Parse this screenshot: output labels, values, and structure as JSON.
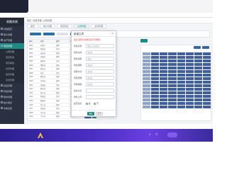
{
  "sidebar": {
    "title": "易融系统",
    "items": [
      {
        "label": "系统首页"
      },
      {
        "label": "客户管理"
      },
      {
        "label": "资产管理"
      },
      {
        "label": "项目管理",
        "active": true
      },
      {
        "label": "立项管理",
        "sub": true,
        "active": true
      },
      {
        "label": "项目查询",
        "sub": true
      },
      {
        "label": "项目审批",
        "sub": true
      },
      {
        "label": "合同管理",
        "sub": true
      },
      {
        "label": "放款管理",
        "sub": true
      },
      {
        "label": "还款管理",
        "sub": true
      },
      {
        "label": "贷后管理"
      },
      {
        "label": "风险管理"
      },
      {
        "label": "财务管理"
      },
      {
        "label": "统计报表"
      },
      {
        "label": "系统设置"
      }
    ]
  },
  "header": {
    "breadcrumb": "首页 / 项目管理 / 立项管理"
  },
  "tabs": [
    {
      "label": "首页"
    },
    {
      "label": "客户管理"
    },
    {
      "label": "项目列表"
    },
    {
      "label": "立项管理",
      "active": true
    },
    {
      "label": "合同管理"
    }
  ],
  "table": {
    "headers": [
      "编号",
      "名称",
      "类型",
      "状态"
    ],
    "rows": [
      [
        "0001",
        "房地产",
        "抵押",
        "审批中"
      ],
      [
        "0002",
        "制造业",
        "信用",
        "已放款"
      ],
      [
        "0003",
        "批发业",
        "担保",
        "审批中"
      ],
      [
        "0004",
        "运输业",
        "抵押",
        "已完成"
      ],
      [
        "0005",
        "建筑业",
        "信用",
        "审批中"
      ],
      [
        "0006",
        "零售业",
        "担保",
        "已放款"
      ],
      [
        "0007",
        "服务业",
        "抵押",
        "已完成"
      ],
      [
        "0008",
        "农业",
        "信用",
        "审批中"
      ],
      [
        "0009",
        "餐饮业",
        "担保",
        "已放款"
      ],
      [
        "0010",
        "信息业",
        "抵押",
        "审批中"
      ],
      [
        "0011",
        "金融业",
        "信用",
        "已完成"
      ],
      [
        "0012",
        "教育业",
        "担保",
        "审批中"
      ],
      [
        "0013",
        "医疗业",
        "抵押",
        "已放款"
      ],
      [
        "0014",
        "物流业",
        "信用",
        "已完成"
      ],
      [
        "0015",
        "能源业",
        "担保",
        "审批中"
      ],
      [
        "0016",
        "化工业",
        "抵押",
        "已放款"
      ],
      [
        "0017",
        "纺织业",
        "信用",
        "审批中"
      ],
      [
        "0018",
        "电子业",
        "担保",
        "已完成"
      ],
      [
        "0019",
        "汽车业",
        "抵押",
        "审批中"
      ]
    ]
  },
  "modal": {
    "title": "新增立项",
    "close": "×",
    "warning": "注意:项目信息填写后不可修改",
    "fields": [
      {
        "label": "项目名称:",
        "placeholder": "请输入项目名称"
      },
      {
        "label": "借款主体:",
        "placeholder": "请选择"
      },
      {
        "label": "借款金额:",
        "placeholder": "请输入"
      },
      {
        "label": "借款期限:",
        "placeholder": "请选择"
      },
      {
        "label": "担保方式:",
        "placeholder": "请选择"
      },
      {
        "label": "项目经理:",
        "placeholder": "请选择"
      },
      {
        "label": "风险等级:",
        "placeholder": "请选择"
      },
      {
        "label": "备注信息:",
        "placeholder": ""
      },
      {
        "label": "附件上传:",
        "placeholder": ""
      }
    ],
    "radio_label": "是否加急:",
    "radio_options": [
      "是",
      "否"
    ],
    "confirm": "确定",
    "cancel": "取消"
  },
  "bottom_bar": {
    "text": "",
    "button": ""
  }
}
